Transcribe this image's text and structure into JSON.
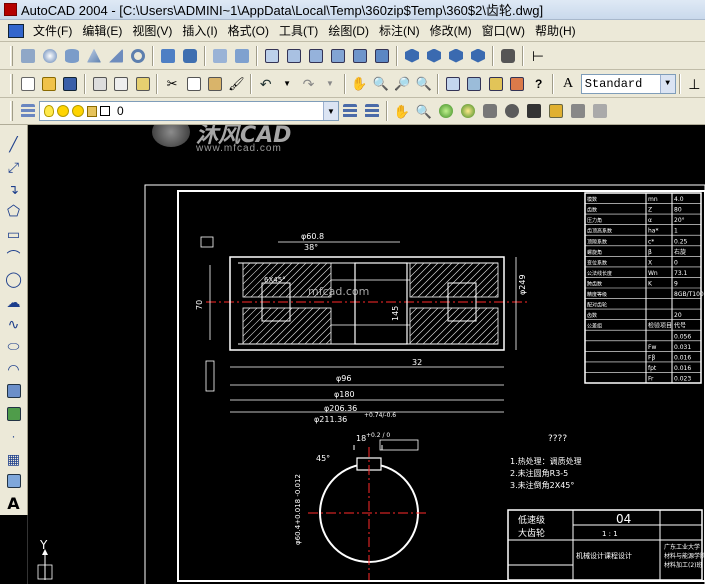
{
  "window": {
    "title": "AutoCAD 2004 - [C:\\Users\\ADMINI~1\\AppData\\Local\\Temp\\360zip$Temp\\360$2\\齿轮.dwg]"
  },
  "menubar": {
    "items": [
      "文件(F)",
      "编辑(E)",
      "视图(V)",
      "插入(I)",
      "格式(O)",
      "工具(T)",
      "绘图(D)",
      "标注(N)",
      "修改(M)",
      "窗口(W)",
      "帮助(H)"
    ]
  },
  "toolbar": {
    "text_style": "Standard"
  },
  "layer": {
    "current": "0"
  },
  "watermark": {
    "brand": "沐风CAD",
    "url": "www.mfcad.com",
    "center_url": "mfcad.com"
  },
  "drawing": {
    "dims": {
      "d60": "φ60.8",
      "angle38": "38°",
      "d70": "70",
      "d32": "32",
      "d145": "145",
      "d96": "φ96",
      "d180": "φ180",
      "d20636": "φ206.36",
      "d21136": "φ211.36",
      "tol": "+0.74/-0.6",
      "cx": "6X45°",
      "w18": "18",
      "tol18": "+0.2 / 0",
      "dia_bore": "φ60.4+0.018 -0.012",
      "ang45": "45°",
      "d249": "φ249"
    },
    "question": "????",
    "notes": [
      "1.热处理：调质处理",
      "2.未注圆角R3-5",
      "3.未注倒角2X45°"
    ],
    "title_block": {
      "line1": "低速级",
      "line2": "大齿轮",
      "number": "04",
      "scale": "1 : 1",
      "course": "机械设计课程设计",
      "school": "广东工业大学",
      "dept": "材料与能源学院",
      "cls": "材料加工(2)班"
    },
    "gear_table": {
      "rows": [
        [
          "模数",
          "mn",
          "4.0"
        ],
        [
          "齿数",
          "Z",
          "80"
        ],
        [
          "压力角",
          "α",
          "20°"
        ],
        [
          "齿顶高系数",
          "ha*",
          "1"
        ],
        [
          "顶隙系数",
          "c*",
          "0.25"
        ],
        [
          "螺旋角",
          "β",
          "右旋"
        ],
        [
          "变位系数",
          "X",
          "0"
        ],
        [
          "公法线长度",
          "Wn",
          "73.1"
        ],
        [
          "跨齿数",
          "K",
          "9"
        ],
        [
          "精度等级",
          "",
          "8GB/T10095"
        ],
        [
          "配对齿轮",
          "",
          ""
        ],
        [
          "齿数",
          "",
          "20"
        ],
        [
          "公差组",
          "检验项目",
          "代号"
        ],
        [
          "",
          "",
          "0.056"
        ],
        [
          "",
          "Fw",
          "0.031"
        ],
        [
          "",
          "Fβ",
          "0.016"
        ],
        [
          "",
          "fpt",
          "0.016"
        ],
        [
          "",
          "Fr",
          "0.023"
        ]
      ]
    }
  },
  "ucs": {
    "axis": "Y"
  }
}
